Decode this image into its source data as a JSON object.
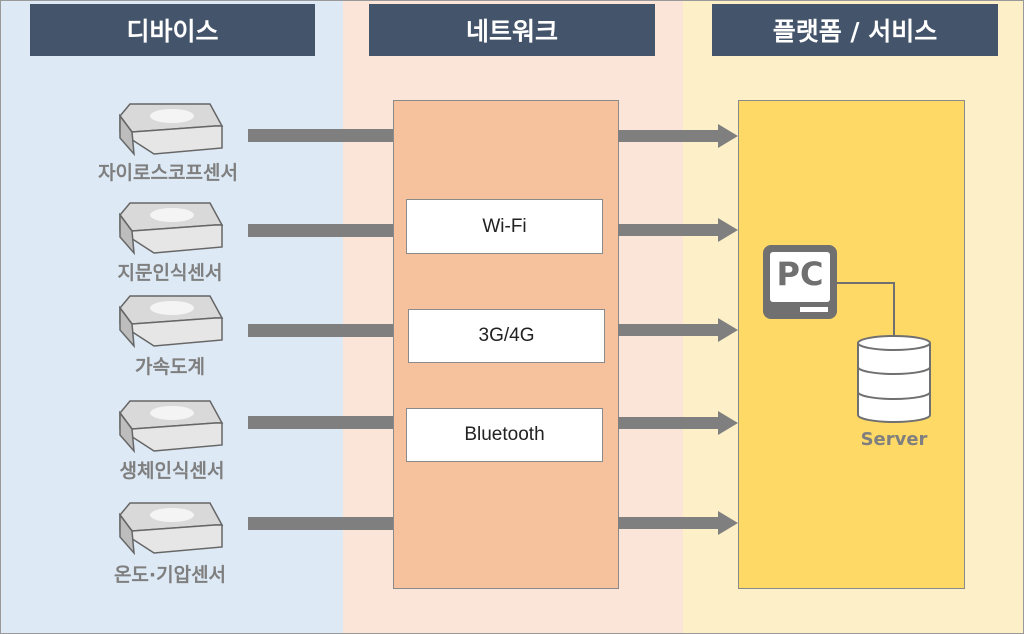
{
  "columns": {
    "devices": "디바이스",
    "network": "네트워크",
    "platform": "플랫폼 / 서비스"
  },
  "devices": [
    {
      "label": "자이로스코프센서"
    },
    {
      "label": "지문인식센서"
    },
    {
      "label": "가속도계"
    },
    {
      "label": "생체인식센서"
    },
    {
      "label": "온도·기압센서"
    }
  ],
  "network": [
    {
      "label": "Wi-Fi"
    },
    {
      "label": "3G/4G"
    },
    {
      "label": "Bluetooth"
    }
  ],
  "platform": {
    "pc_label": "PC",
    "server_label": "Server"
  },
  "colors": {
    "header": "#44546a",
    "devices_bg": "#dde9f5",
    "network_bg": "#fae5d8",
    "platform_bg": "#fdf0c8",
    "network_box": "#f5c29d",
    "platform_box": "#ffd966",
    "arrow": "#7f7f7f"
  }
}
